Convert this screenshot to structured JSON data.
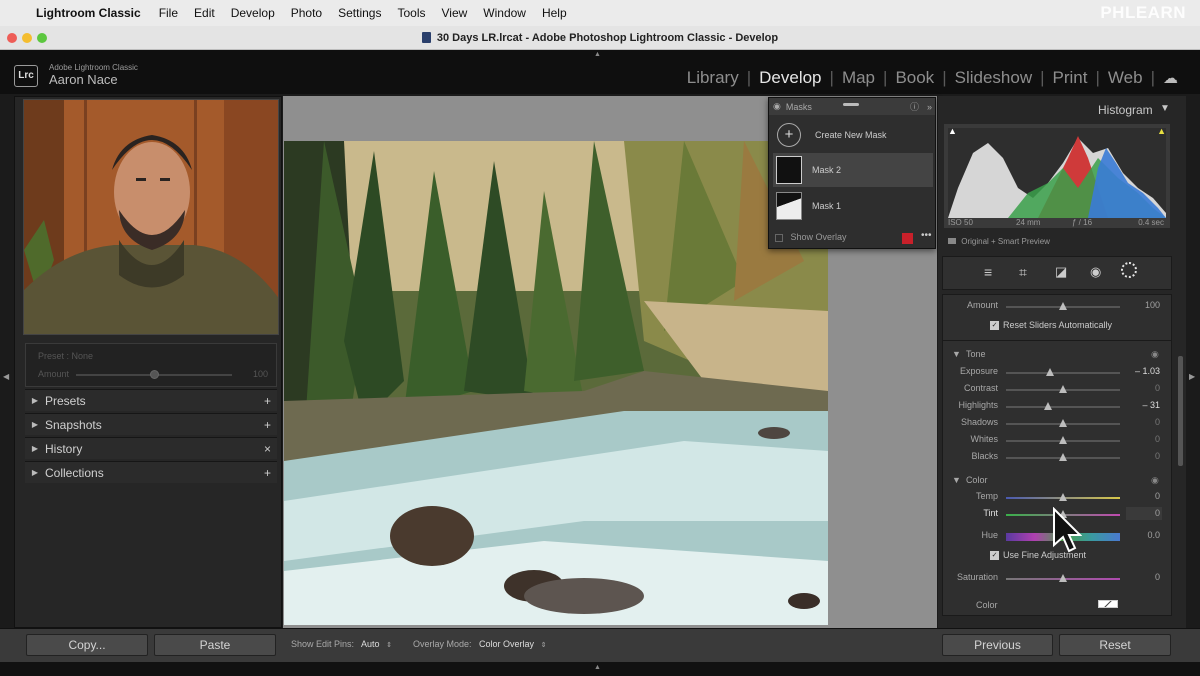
{
  "menubar": {
    "app": "Lightroom Classic",
    "items": [
      "File",
      "Edit",
      "Develop",
      "Photo",
      "Settings",
      "Tools",
      "View",
      "Window",
      "Help"
    ],
    "watermark": "PHLEARN"
  },
  "window": {
    "title": "30 Days LR.lrcat - Adobe Photoshop Lightroom Classic - Develop"
  },
  "identity": {
    "logo": "Lrc",
    "small": "Adobe Lightroom Classic",
    "name": "Aaron Nace"
  },
  "modules": [
    "Library",
    "Develop",
    "Map",
    "Book",
    "Slideshow",
    "Print",
    "Web"
  ],
  "active_module": "Develop",
  "left": {
    "preset_label": "Preset : None",
    "amount_label": "Amount",
    "amount_value": "100",
    "panels": [
      {
        "label": "Presets",
        "action": "+"
      },
      {
        "label": "Snapshots",
        "action": "+"
      },
      {
        "label": "History",
        "action": "×"
      },
      {
        "label": "Collections",
        "action": "+"
      }
    ],
    "copy_label": "Copy...",
    "paste_label": "Paste"
  },
  "toolbar": {
    "edit_pins_label": "Show Edit Pins:",
    "edit_pins_value": "Auto",
    "overlay_label": "Overlay Mode:",
    "overlay_value": "Color Overlay"
  },
  "masks": {
    "title": "Masks",
    "create": "Create New Mask",
    "items": [
      "Mask 2",
      "Mask 1"
    ],
    "show_overlay": "Show Overlay",
    "overlay_color": "#c8202a"
  },
  "histogram": {
    "title": "Histogram",
    "iso": "ISO 50",
    "focal": "24 mm",
    "aperture": "ƒ / 16",
    "shutter": "0.4 sec",
    "preview": "Original + Smart Preview"
  },
  "adjust": {
    "amount_label": "Amount",
    "amount_value": "100",
    "reset_sliders": "Reset Sliders Automatically",
    "tone_title": "Tone",
    "tone": [
      {
        "label": "Exposure",
        "value": "– 1.03",
        "pos": 0.39
      },
      {
        "label": "Contrast",
        "value": "0",
        "pos": 0.5
      },
      {
        "label": "Highlights",
        "value": "– 31",
        "pos": 0.37
      },
      {
        "label": "Shadows",
        "value": "0",
        "pos": 0.5
      },
      {
        "label": "Whites",
        "value": "0",
        "pos": 0.5
      },
      {
        "label": "Blacks",
        "value": "0",
        "pos": 0.5
      }
    ],
    "color_title": "Color",
    "color": [
      {
        "label": "Temp",
        "value": "0",
        "pos": 0.5
      },
      {
        "label": "Tint",
        "value": "0",
        "pos": 0.5
      }
    ],
    "hue_label": "Hue",
    "hue_value": "0.0",
    "fine_adjust": "Use Fine Adjustment",
    "saturation_label": "Saturation",
    "saturation_value": "0",
    "saturation_pos": 0.5,
    "color_label": "Color",
    "previous_label": "Previous",
    "reset_label": "Reset"
  }
}
